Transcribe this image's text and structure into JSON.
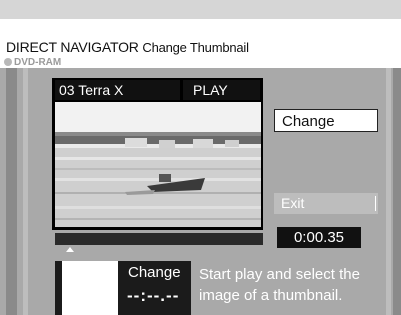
{
  "header": {
    "title": "DIRECT NAVIGATOR",
    "subtitle": "Change Thumbnail",
    "media": "DVD-RAM"
  },
  "preview": {
    "program_name": "03 Terra X",
    "status": "PLAY"
  },
  "buttons": {
    "change": "Change",
    "exit": "Exit"
  },
  "playback": {
    "current_time": "0:00.35"
  },
  "thumbnail": {
    "label": "Change",
    "time": "--:--.--"
  },
  "help_text": "Start play and select the image of a thumbnail."
}
